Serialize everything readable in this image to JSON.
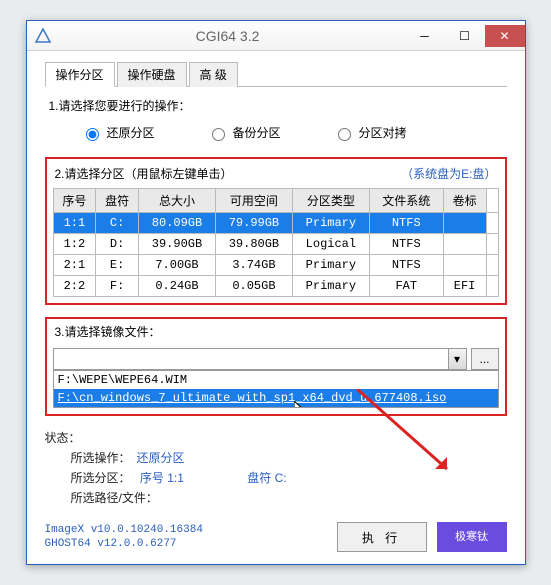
{
  "title": "CGI64 3.2",
  "tabs": [
    "操作分区",
    "操作硬盘",
    "高 级"
  ],
  "section1": {
    "label": "1.请选择您要进行的操作：",
    "options": [
      "还原分区",
      "备份分区",
      "分区对拷"
    ],
    "selected": 0
  },
  "section2": {
    "label": "2.请选择分区（用鼠标左键单击）",
    "sys_note": "（系统盘为E:盘）",
    "columns": [
      "序号",
      "盘符",
      "总大小",
      "可用空间",
      "分区类型",
      "文件系统",
      "卷标"
    ]
  },
  "partitions": [
    {
      "id": "1:1",
      "drv": "C:",
      "total": "80.09GB",
      "free": "79.99GB",
      "ptype": "Primary",
      "fs": "NTFS",
      "vol": "",
      "sel": true
    },
    {
      "id": "1:2",
      "drv": "D:",
      "total": "39.90GB",
      "free": "39.80GB",
      "ptype": "Logical",
      "fs": "NTFS",
      "vol": "",
      "sel": false
    },
    {
      "id": "2:1",
      "drv": "E:",
      "total": "7.00GB",
      "free": "3.74GB",
      "ptype": "Primary",
      "fs": "NTFS",
      "vol": "",
      "sel": false
    },
    {
      "id": "2:2",
      "drv": "F:",
      "total": "0.24GB",
      "free": "0.05GB",
      "ptype": "Primary",
      "fs": "FAT",
      "vol": "EFI",
      "sel": false
    }
  ],
  "section3": {
    "label": "3.请选择镜像文件：",
    "browse": "...",
    "list": [
      {
        "text": "F:\\WEPE\\WEPE64.WIM",
        "sel": false
      },
      {
        "text": "F:\\cn_windows_7_ultimate_with_sp1_x64_dvd_u_677408.iso",
        "sel": true
      }
    ]
  },
  "status": {
    "head": "状态：",
    "l1a": "所选操作：",
    "l1b": "还原分区",
    "l2a": "所选分区：",
    "l2b": "序号 1:1",
    "l2c": "盘符 C:",
    "l3a": "所选路径/文件："
  },
  "version": {
    "l1": "ImageX v10.0.10240.16384",
    "l2": "GHOST64 v12.0.0.6277"
  },
  "exec": "执 行",
  "watermark": {
    "l1": "极寒钛",
    "l2": ""
  }
}
